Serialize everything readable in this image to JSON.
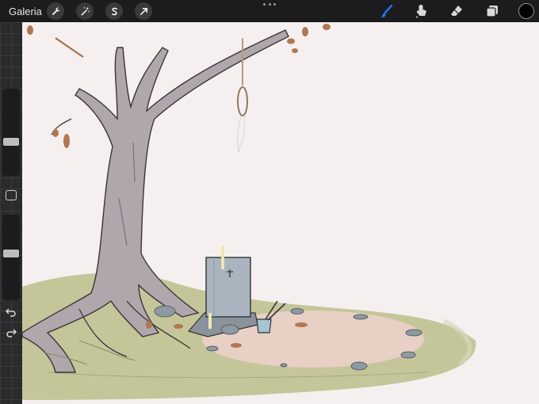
{
  "topbar": {
    "gallery_label": "Galeria",
    "tools_left": [
      {
        "name": "actions",
        "icon": "wrench-icon"
      },
      {
        "name": "adjustments",
        "icon": "magic-wand-icon"
      },
      {
        "name": "selection",
        "icon": "selection-s-icon"
      },
      {
        "name": "transform",
        "icon": "arrow-cursor-icon"
      }
    ],
    "tools_right": [
      {
        "name": "brush",
        "icon": "brush-icon",
        "active": true
      },
      {
        "name": "smudge",
        "icon": "smudge-finger-icon"
      },
      {
        "name": "eraser",
        "icon": "eraser-icon"
      },
      {
        "name": "layers",
        "icon": "layers-icon"
      }
    ],
    "current_color": "#000000",
    "active_color": "#1e7cf2"
  },
  "sidebar": {
    "brush_size_level": 0.38,
    "opacity_level": 0.55
  }
}
